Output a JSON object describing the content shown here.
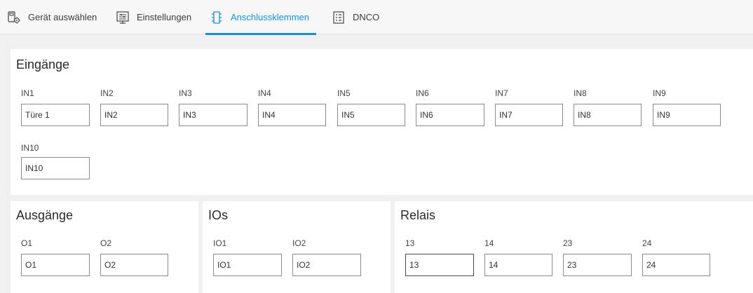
{
  "tabs": [
    {
      "label": "Gerät auswählen",
      "icon": "device-select-icon",
      "active": false
    },
    {
      "label": "Einstellungen",
      "icon": "settings-monitor-icon",
      "active": false
    },
    {
      "label": "Anschlussklemmen",
      "icon": "terminal-icon",
      "active": true
    },
    {
      "label": "DNCO",
      "icon": "document-list-icon",
      "active": false
    }
  ],
  "inputs_panel": {
    "title": "Eingänge",
    "fields": [
      {
        "label": "IN1",
        "value": "Türe 1"
      },
      {
        "label": "IN2",
        "value": "IN2"
      },
      {
        "label": "IN3",
        "value": "IN3"
      },
      {
        "label": "IN4",
        "value": "IN4"
      },
      {
        "label": "IN5",
        "value": "IN5"
      },
      {
        "label": "IN6",
        "value": "IN6"
      },
      {
        "label": "IN7",
        "value": "IN7"
      },
      {
        "label": "IN8",
        "value": "IN8"
      },
      {
        "label": "IN9",
        "value": "IN9"
      },
      {
        "label": "IN10",
        "value": "IN10"
      }
    ]
  },
  "outputs_panel": {
    "title": "Ausgänge",
    "fields": [
      {
        "label": "O1",
        "value": "O1"
      },
      {
        "label": "O2",
        "value": "O2"
      }
    ]
  },
  "ios_panel": {
    "title": "IOs",
    "fields": [
      {
        "label": "IO1",
        "value": "IO1"
      },
      {
        "label": "IO2",
        "value": "IO2"
      }
    ]
  },
  "relais_panel": {
    "title": "Relais",
    "fields": [
      {
        "label": "13",
        "value": "13"
      },
      {
        "label": "14",
        "value": "14"
      },
      {
        "label": "23",
        "value": "23"
      },
      {
        "label": "24",
        "value": "24"
      }
    ]
  },
  "colors": {
    "accent": "#1a8fd8",
    "background": "#f0f0f0",
    "panel": "#ffffff"
  }
}
